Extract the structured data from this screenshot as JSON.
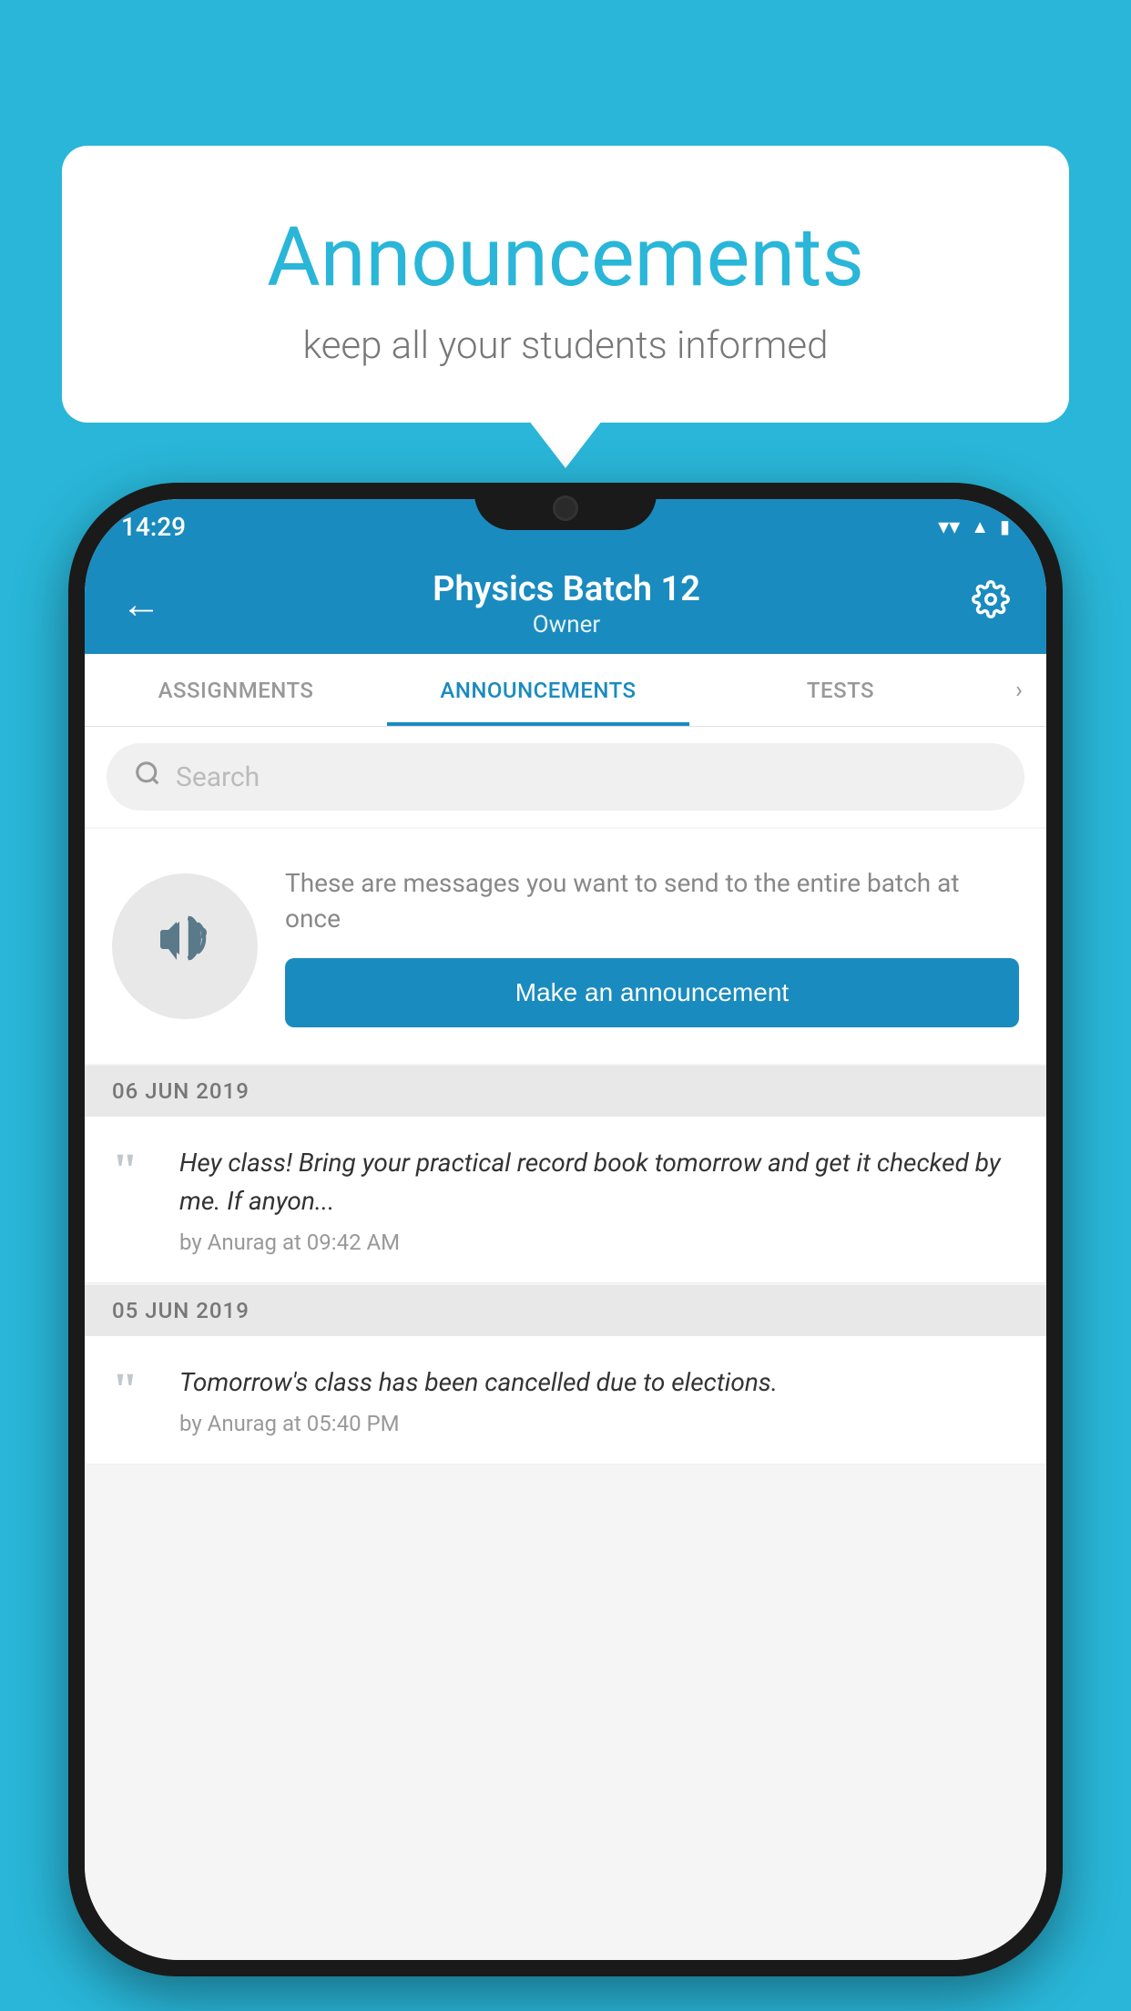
{
  "background_color": "#29b6d8",
  "speech_bubble": {
    "title": "Announcements",
    "subtitle": "keep all your students informed"
  },
  "phone": {
    "status_bar": {
      "time": "14:29",
      "wifi_icon": "wifi",
      "signal_icon": "signal",
      "battery_icon": "battery"
    },
    "app_bar": {
      "back_label": "←",
      "title": "Physics Batch 12",
      "subtitle": "Owner",
      "settings_icon": "settings"
    },
    "tabs": [
      {
        "label": "ASSIGNMENTS",
        "active": false
      },
      {
        "label": "ANNOUNCEMENTS",
        "active": true
      },
      {
        "label": "TESTS",
        "active": false
      }
    ],
    "search": {
      "placeholder": "Search"
    },
    "announcement_prompt": {
      "description": "These are messages you want to send to the entire batch at once",
      "button_label": "Make an announcement"
    },
    "announcements": [
      {
        "date": "06  JUN  2019",
        "message": "Hey class! Bring your practical record book tomorrow and get it checked by me. If anyon...",
        "meta": "by Anurag at 09:42 AM"
      },
      {
        "date": "05  JUN  2019",
        "message": "Tomorrow's class has been cancelled due to elections.",
        "meta": "by Anurag at 05:40 PM"
      }
    ]
  }
}
